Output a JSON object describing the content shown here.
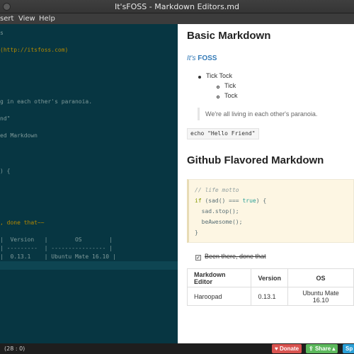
{
  "window": {
    "title": "It'sFOSS - Markdown Editors.md"
  },
  "menu": {
    "items": [
      "sert",
      "View",
      "Help"
    ]
  },
  "editor": {
    "lines": [
      {
        "text": "s",
        "color": "gray"
      },
      {
        "text": "(http://itsfoss.com)",
        "color": "orange"
      },
      {
        "text": "g in each other's paranoia.",
        "color": "gray"
      },
      {
        "text": "nd\"",
        "color": "gray"
      },
      {
        "text": "ed Markdown",
        "color": "gray"
      },
      {
        "text": ") {",
        "color": "gray"
      },
      {
        "text": ", done that~~",
        "color": "orange"
      },
      {
        "text": "|  Version   |        OS        |",
        "color": "gray"
      },
      {
        "text": "| ---------  | ---------------- |",
        "color": "gray"
      },
      {
        "text": "|  0.13.1    | Ubuntu Mate 16.10 |",
        "color": "gray"
      }
    ]
  },
  "preview": {
    "h1_basic": "Basic Markdown",
    "link_prefix": "It's ",
    "link_strong": "FOSS",
    "list_top": "Tick Tock",
    "list_sub": [
      "Tick",
      "Tock"
    ],
    "blockquote": "We're all living in each other's paranoia.",
    "inline_code": "echo \"Hello Friend\"",
    "h1_github": "Github Flavored Markdown",
    "code": {
      "comment": "// life motto",
      "if_kw": "if",
      "if_mid": " (sad() === ",
      "if_bool": "true",
      "if_end": ") {",
      "line3": "  sad.stop();",
      "line4": "  beAwesome();",
      "line5": "}"
    },
    "task": "Been there, done that",
    "table": {
      "headers": [
        "Markdown Editor",
        "Version",
        "OS"
      ],
      "row": [
        "Haroopad",
        "0.13.1",
        "Ubuntu Mate 16.10"
      ]
    }
  },
  "status": {
    "position": "(28 : 0)",
    "donate": "Donate",
    "share": "Share",
    "third": "Sp",
    "colors": {
      "donate": "#d9534f",
      "share": "#5cb85c",
      "third": "#2a9fd6"
    }
  }
}
